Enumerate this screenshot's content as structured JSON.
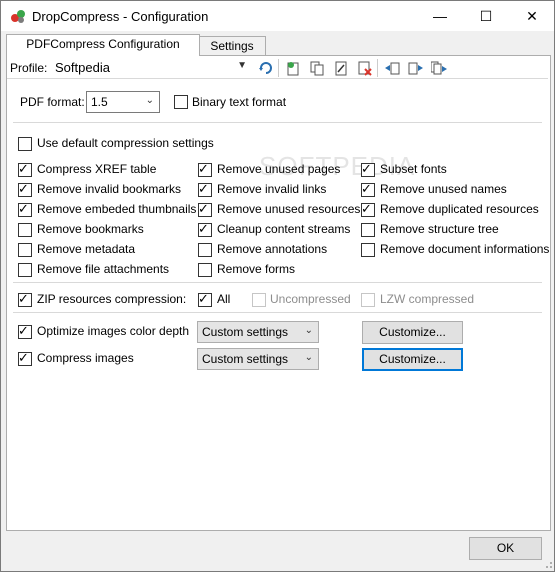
{
  "window": {
    "title": "DropCompress - Configuration",
    "minimize_icon": "minimize-icon",
    "maximize_icon": "maximize-icon",
    "close_icon": "close-icon"
  },
  "tabs": [
    {
      "label": "PDFCompress Configuration",
      "active": true
    },
    {
      "label": "Settings",
      "active": false
    }
  ],
  "profile": {
    "label": "Profile:",
    "value": "Softpedia"
  },
  "toolbar_icons": [
    "refresh-icon",
    "new-profile-icon",
    "copy-profile-icon",
    "edit-profile-icon",
    "delete-profile-icon",
    "import-icon",
    "export-icon",
    "export-all-icon"
  ],
  "pdf_format": {
    "label": "PDF format:",
    "value": "1.5"
  },
  "binary_text": {
    "label": "Binary text format",
    "checked": false
  },
  "use_default": {
    "label": "Use default compression settings",
    "checked": false
  },
  "options_col1": [
    {
      "label": "Compress XREF table",
      "checked": true
    },
    {
      "label": "Remove invalid bookmarks",
      "checked": true
    },
    {
      "label": "Remove embeded thumbnails",
      "checked": true
    },
    {
      "label": "Remove bookmarks",
      "checked": false
    },
    {
      "label": "Remove metadata",
      "checked": false
    },
    {
      "label": "Remove file attachments",
      "checked": false
    }
  ],
  "options_col2": [
    {
      "label": "Remove unused pages",
      "checked": true
    },
    {
      "label": "Remove invalid links",
      "checked": true
    },
    {
      "label": "Remove unused resources",
      "checked": true
    },
    {
      "label": "Cleanup content streams",
      "checked": true
    },
    {
      "label": "Remove annotations",
      "checked": false
    },
    {
      "label": "Remove forms",
      "checked": false
    }
  ],
  "options_col3": [
    {
      "label": "Subset fonts",
      "checked": true
    },
    {
      "label": "Remove unused names",
      "checked": true
    },
    {
      "label": "Remove duplicated resources",
      "checked": true
    },
    {
      "label": "Remove structure tree",
      "checked": false
    },
    {
      "label": "Remove document informations",
      "checked": false
    }
  ],
  "zip": {
    "label": "ZIP resources compression:",
    "checked": true,
    "all_label": "All",
    "all_checked": true,
    "uncompressed_label": "Uncompressed",
    "lzw_label": "LZW compressed"
  },
  "optimize_images": {
    "label": "Optimize images color depth",
    "checked": true,
    "select_value": "Custom settings",
    "button_label": "Customize..."
  },
  "compress_images": {
    "label": "Compress images",
    "checked": true,
    "select_value": "Custom settings",
    "button_label": "Customize..."
  },
  "ok_label": "OK",
  "watermark": "SOFTPEDIA"
}
